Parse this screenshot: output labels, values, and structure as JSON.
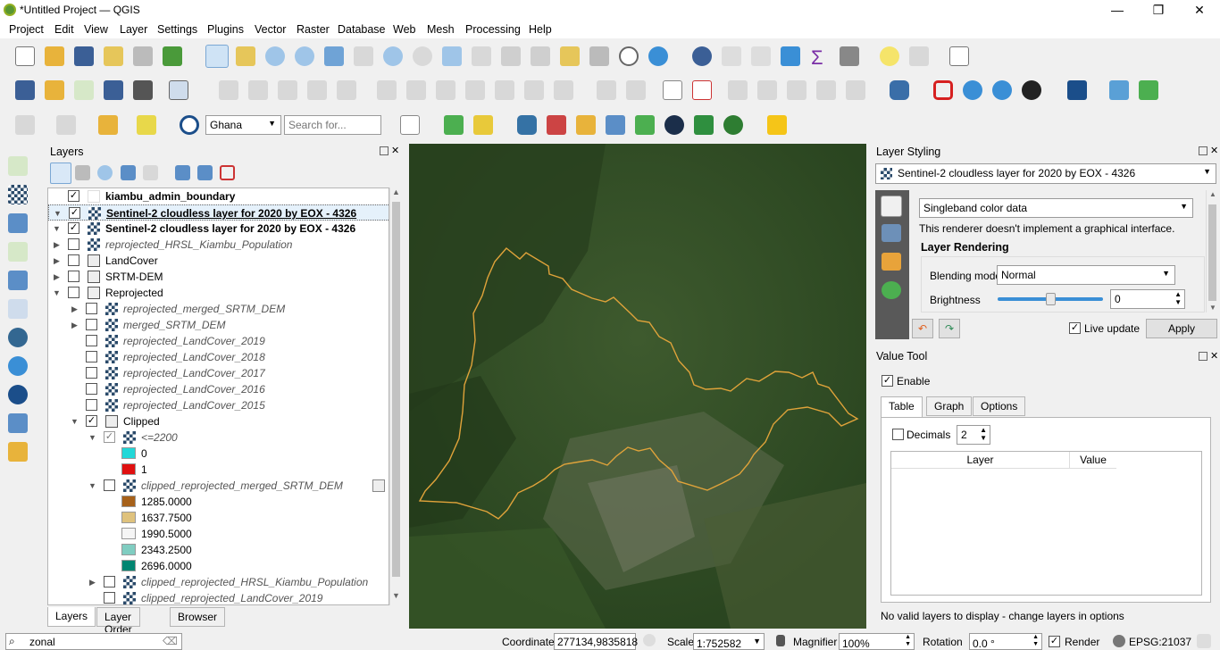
{
  "window": {
    "title": "*Untitled Project — QGIS",
    "minimize": "—",
    "restore": "❐",
    "close": "✕"
  },
  "menu": [
    "Project",
    "Edit",
    "View",
    "Layer",
    "Settings",
    "Plugins",
    "Vector",
    "Raster",
    "Database",
    "Web",
    "Mesh",
    "Processing",
    "Help"
  ],
  "toolbar3": {
    "locator_combo": "Ghana",
    "search_placeholder": "Search for..."
  },
  "layers_panel": {
    "title": "Layers",
    "tabs": [
      "Layers",
      "Layer Order",
      "Browser"
    ],
    "items": [
      {
        "label": "kiambu_admin_boundary",
        "checked": true,
        "style": "bold"
      },
      {
        "label": "Sentinel-2 cloudless layer for 2020 by EOX - 4326",
        "checked": true,
        "style": "bold-selected"
      },
      {
        "label": "Sentinel-2 cloudless layer for 2020 by EOX - 4326",
        "checked": true,
        "style": "bold"
      },
      {
        "label": "reprojected_HRSL_Kiambu_Population",
        "checked": false,
        "style": "italic"
      },
      {
        "label": "LandCover",
        "checked": false,
        "style": "group"
      },
      {
        "label": "SRTM-DEM",
        "checked": false,
        "style": "group"
      },
      {
        "label": "Reprojected",
        "checked": false,
        "style": "group"
      },
      {
        "label": "reprojected_merged_SRTM_DEM",
        "checked": false,
        "style": "italic"
      },
      {
        "label": "merged_SRTM_DEM",
        "checked": false,
        "style": "italic"
      },
      {
        "label": "reprojected_LandCover_2019",
        "checked": false,
        "style": "italic"
      },
      {
        "label": "reprojected_LandCover_2018",
        "checked": false,
        "style": "italic"
      },
      {
        "label": "reprojected_LandCover_2017",
        "checked": false,
        "style": "italic"
      },
      {
        "label": "reprojected_LandCover_2016",
        "checked": false,
        "style": "italic"
      },
      {
        "label": "reprojected_LandCover_2015",
        "checked": false,
        "style": "italic"
      },
      {
        "label": "Clipped",
        "checked": true,
        "style": "group"
      },
      {
        "label": "<=2200",
        "checked": true,
        "style": "italic"
      },
      {
        "label": "0",
        "color": "#22d8d8"
      },
      {
        "label": "1",
        "color": "#e01010"
      },
      {
        "label": "clipped_reprojected_merged_SRTM_DEM",
        "checked": false,
        "style": "italic"
      },
      {
        "label": "1285.0000",
        "color": "#a6611a"
      },
      {
        "label": "1637.7500",
        "color": "#dfc27d"
      },
      {
        "label": "1990.5000",
        "color": "#f5f5f5"
      },
      {
        "label": "2343.2500",
        "color": "#80cdc1"
      },
      {
        "label": "2696.0000",
        "color": "#018571"
      },
      {
        "label": "clipped_reprojected_HRSL_Kiambu_Population",
        "checked": false,
        "style": "italic"
      },
      {
        "label": "clipped_reprojected_LandCover_2019",
        "checked": false,
        "style": "italic"
      }
    ]
  },
  "layer_styling": {
    "title": "Layer Styling",
    "layer_combo": "Sentinel-2 cloudless layer for 2020 by EOX - 4326",
    "renderer": "Singleband color data",
    "renderer_note": "This renderer doesn't implement a graphical interface.",
    "section": "Layer Rendering",
    "blending_label": "Blending mode",
    "blending_value": "Normal",
    "brightness_label": "Brightness",
    "brightness_value": "0",
    "brightness_level": 0.5,
    "live_update_label": "Live update",
    "apply_label": "Apply"
  },
  "value_tool": {
    "title": "Value Tool",
    "enable_label": "Enable",
    "tabs": [
      "Table",
      "Graph",
      "Options"
    ],
    "decimals_label": "Decimals",
    "decimals_value": "2",
    "col_layer": "Layer",
    "col_value": "Value",
    "status": "No valid layers to display - change layers in options"
  },
  "statusbar": {
    "search_value": "zonal",
    "coordinate_label": "Coordinate",
    "coordinate_value": "277134,9835818",
    "scale_label": "Scale",
    "scale_value": "1:752582",
    "magnifier_label": "Magnifier",
    "magnifier_value": "100%",
    "rotation_label": "Rotation",
    "rotation_value": "0.0 °",
    "render_label": "Render",
    "crs": "EPSG:21037"
  }
}
